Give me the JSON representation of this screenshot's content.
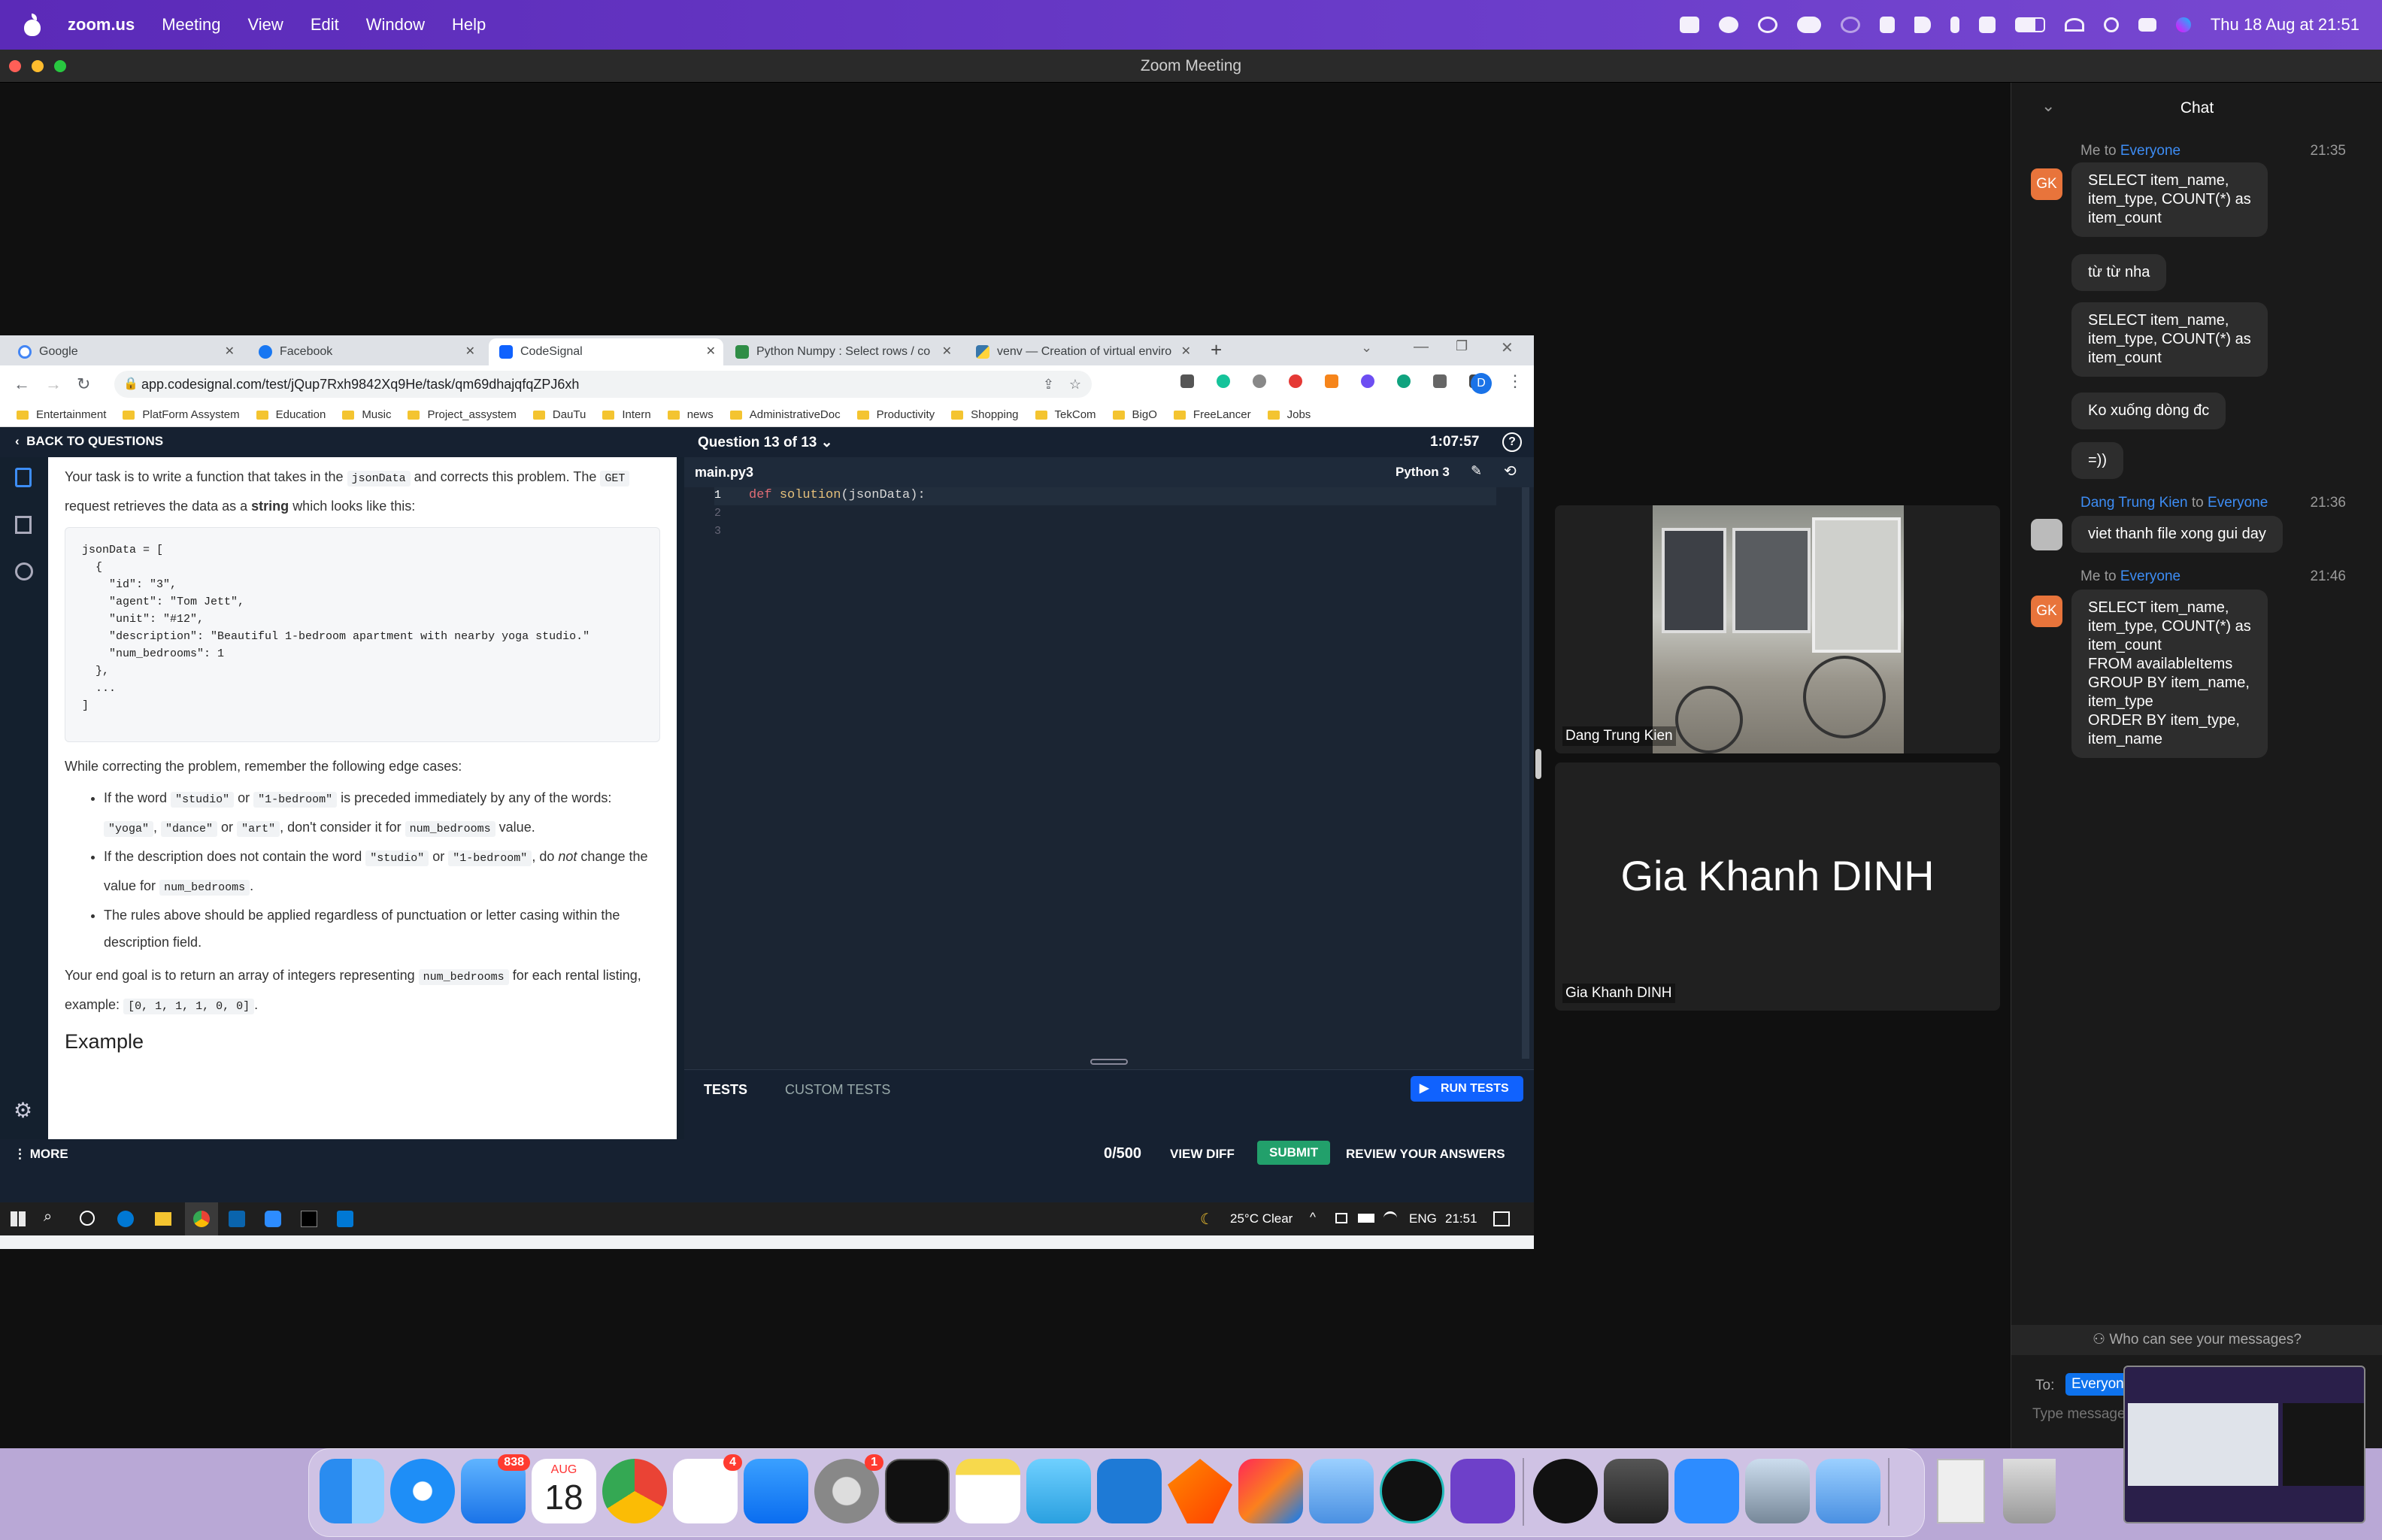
{
  "menubar": {
    "app_name": "zoom.us",
    "menus": [
      "Meeting",
      "View",
      "Edit",
      "Window",
      "Help"
    ],
    "clock": "Thu 18 Aug at  21:51"
  },
  "zoom": {
    "window_title": "Zoom Meeting"
  },
  "browser": {
    "tabs": [
      {
        "label": "Google",
        "icon": "google-icon",
        "color": "#4285f4"
      },
      {
        "label": "Facebook",
        "icon": "facebook-icon",
        "color": "#1877f2"
      },
      {
        "label": "CodeSignal",
        "icon": "codesignal-icon",
        "color": "#1062fe"
      },
      {
        "label": "Python Numpy : Select rows / co",
        "icon": "geeks-icon",
        "color": "#2f8d46"
      },
      {
        "label": "venv — Creation of virtual enviro",
        "icon": "python-icon",
        "color": "#3776ab"
      }
    ],
    "url": "app.codesignal.com/test/jQup7Rxh9842Xq9He/task/qm69dhajqfqZPJ6xh",
    "profile_initial": "D",
    "bookmarks": [
      "Entertainment",
      "PlatForm Assystem",
      "Education",
      "Music",
      "Project_assystem",
      "DauTu",
      "Intern",
      "news",
      "AdministrativeDoc",
      "Productivity",
      "Shopping",
      "TekCom",
      "BigO",
      "FreeLancer",
      "Jobs"
    ]
  },
  "codesignal": {
    "back_label": "BACK TO QUESTIONS",
    "question_label": "Question 13 of 13",
    "timer": "1:07:57",
    "task": {
      "p1_a": "Your task is to write a function that takes in the",
      "p1_code": "jsonData",
      "p1_b": "and corrects this problem. The",
      "p1_get": "GET",
      "p1_c": "request retrieves the data as a",
      "p1_string": "string",
      "p1_d": "which looks like this:",
      "code_block": "jsonData = [\n  {\n    \"id\": \"3\",\n    \"agent\": \"Tom Jett\",\n    \"unit\": \"#12\",\n    \"description\": \"Beautiful 1-bedroom apartment with nearby yoga studio.\"\n    \"num_bedrooms\": 1\n  },\n  ...\n]",
      "edge_intro": "While correcting the problem, remember the following edge cases:",
      "b1_a": "If the word",
      "b1_c1": "\"studio\"",
      "b1_or": "or",
      "b1_c2": "\"1-bedroom\"",
      "b1_b": "is preceded immediately by any of the words:",
      "b1_w1": "\"yoga\"",
      "b1_w2": "\"dance\"",
      "b1_w3": "\"art\"",
      "b1_c": ", don't consider it for",
      "b1_c3": "num_bedrooms",
      "b1_d": "value.",
      "b2_a": "If the description does not contain the word",
      "b2_c1": "\"studio\"",
      "b2_or": "or",
      "b2_c2": "\"1-bedroom\"",
      "b2_b": ", do",
      "b2_not": "not",
      "b2_c": "change the value for",
      "b2_c3": "num_bedrooms",
      "b3": "The rules above should be applied regardless of punctuation or letter casing within the description field.",
      "goal_a": "Your end goal is to return an array of integers representing",
      "goal_code": "num_bedrooms",
      "goal_b": "for each rental listing, example:",
      "goal_example": "[0, 1, 1, 1, 0, 0]",
      "example_heading": "Example"
    },
    "editor": {
      "filename": "main.py3",
      "language": "Python 3",
      "line_numbers": [
        "1",
        "2",
        "3"
      ],
      "line1_kw": "def",
      "line1_fn": "solution",
      "line1_rest": "(jsonData):"
    },
    "tests_tabs": [
      "TESTS",
      "CUSTOM TESTS"
    ],
    "run_tests": "RUN TESTS",
    "more": "MORE",
    "score": "0/500",
    "view_diff": "VIEW DIFF",
    "submit": "SUBMIT",
    "review": "REVIEW YOUR ANSWERS"
  },
  "windows_taskbar": {
    "weather": "25°C  Clear",
    "lang": "ENG",
    "time": "21:51"
  },
  "participants": [
    {
      "name": "Dang Trung Kien"
    },
    {
      "name": "Gia Khanh DINH",
      "big_name": "Gia Khanh DINH"
    }
  ],
  "chat": {
    "title": "Chat",
    "messages": [
      {
        "from": "Me",
        "to_word": "to",
        "to": "Everyone",
        "time": "21:35",
        "avatar": "GK",
        "bubbles": [
          "SELECT item_name,\nitem_type, COUNT(*) as\nitem_count",
          "từ từ nha",
          "SELECT item_name,\nitem_type, COUNT(*) as\nitem_count",
          "Ko xuống dòng đc",
          "=))"
        ]
      },
      {
        "from": "Dang Trung Kien",
        "to_word": "to",
        "to": "Everyone",
        "time": "21:36",
        "bubbles": [
          "viet thanh file xong gui day"
        ]
      },
      {
        "from": "Me",
        "to_word": "to",
        "to": "Everyone",
        "time": "21:46",
        "avatar": "GK",
        "bubbles": [
          "SELECT item_name,\nitem_type, COUNT(*) as\nitem_count\nFROM availableItems\nGROUP BY item_name,\nitem_type\nORDER BY item_type,\nitem_name"
        ]
      }
    ],
    "who_can_see": "Who can see your messages?",
    "to_label": "To:",
    "to_value": "Everyone",
    "input_placeholder": "Type message here..."
  },
  "dock": {
    "mail_badge": "838",
    "calendar_month": "AUG",
    "calendar_day": "18",
    "reminders_badge": "4",
    "settings_badge": "1"
  }
}
